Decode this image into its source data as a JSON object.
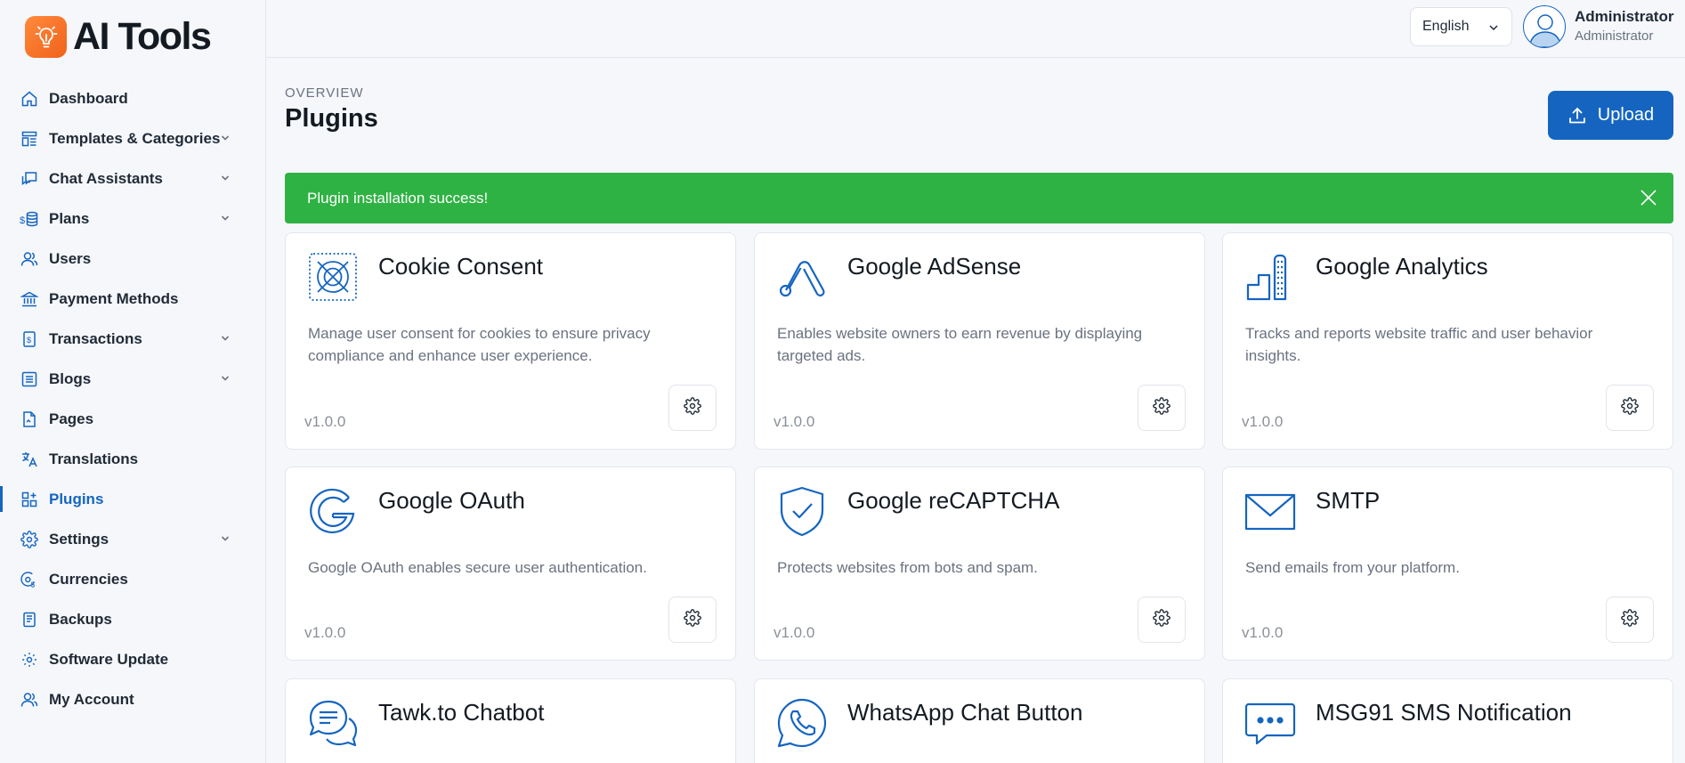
{
  "app": {
    "name": "AI Tools"
  },
  "sidebar": {
    "items": [
      {
        "label": "Dashboard",
        "icon": "home-icon",
        "chevron": false,
        "active": false
      },
      {
        "label": "Templates & Categories",
        "icon": "templates-icon",
        "chevron": true,
        "active": false
      },
      {
        "label": "Chat Assistants",
        "icon": "chat-icon",
        "chevron": true,
        "active": false
      },
      {
        "label": "Plans",
        "icon": "plans-icon",
        "chevron": true,
        "active": false
      },
      {
        "label": "Users",
        "icon": "users-icon",
        "chevron": false,
        "active": false
      },
      {
        "label": "Payment Methods",
        "icon": "bank-icon",
        "chevron": false,
        "active": false
      },
      {
        "label": "Transactions",
        "icon": "transactions-icon",
        "chevron": true,
        "active": false
      },
      {
        "label": "Blogs",
        "icon": "blogs-icon",
        "chevron": true,
        "active": false
      },
      {
        "label": "Pages",
        "icon": "pages-icon",
        "chevron": false,
        "active": false
      },
      {
        "label": "Translations",
        "icon": "translate-icon",
        "chevron": false,
        "active": false
      },
      {
        "label": "Plugins",
        "icon": "plugins-icon",
        "chevron": false,
        "active": true
      },
      {
        "label": "Settings",
        "icon": "gear-icon",
        "chevron": true,
        "active": false
      },
      {
        "label": "Currencies",
        "icon": "currency-icon",
        "chevron": false,
        "active": false
      },
      {
        "label": "Backups",
        "icon": "backup-icon",
        "chevron": false,
        "active": false
      },
      {
        "label": "Software Update",
        "icon": "update-icon",
        "chevron": false,
        "active": false
      },
      {
        "label": "My Account",
        "icon": "account-icon",
        "chevron": false,
        "active": false
      }
    ]
  },
  "topbar": {
    "language": "English",
    "user_name": "Administrator",
    "user_role": "Administrator"
  },
  "header": {
    "overline": "OVERVIEW",
    "title": "Plugins",
    "upload_label": "Upload"
  },
  "alert": {
    "message": "Plugin installation success!"
  },
  "plugins": [
    {
      "name": "Cookie Consent",
      "description": "Manage user consent for cookies to ensure privacy compliance and enhance user experience.",
      "version": "v1.0.0",
      "icon": "cookie-icon"
    },
    {
      "name": "Google AdSense",
      "description": "Enables website owners to earn revenue by displaying targeted ads.",
      "version": "v1.0.0",
      "icon": "adsense-icon"
    },
    {
      "name": "Google Analytics",
      "description": "Tracks and reports website traffic and user behavior insights.",
      "version": "v1.0.0",
      "icon": "analytics-icon"
    },
    {
      "name": "Google OAuth",
      "description": "Google OAuth enables secure user authentication.",
      "version": "v1.0.0",
      "icon": "google-icon"
    },
    {
      "name": "Google reCAPTCHA",
      "description": "Protects websites from bots and spam.",
      "version": "v1.0.0",
      "icon": "shield-check-icon"
    },
    {
      "name": "SMTP",
      "description": "Send emails from your platform.",
      "version": "v1.0.0",
      "icon": "envelope-icon"
    },
    {
      "name": "Tawk.to Chatbot",
      "icon": "chat-bubbles-icon"
    },
    {
      "name": "WhatsApp Chat Button",
      "icon": "whatsapp-icon"
    },
    {
      "name": "MSG91 SMS Notification",
      "icon": "sms-icon"
    }
  ],
  "colors": {
    "accent": "#1565c0",
    "success": "#2fb244",
    "brand": "#f0621a"
  }
}
